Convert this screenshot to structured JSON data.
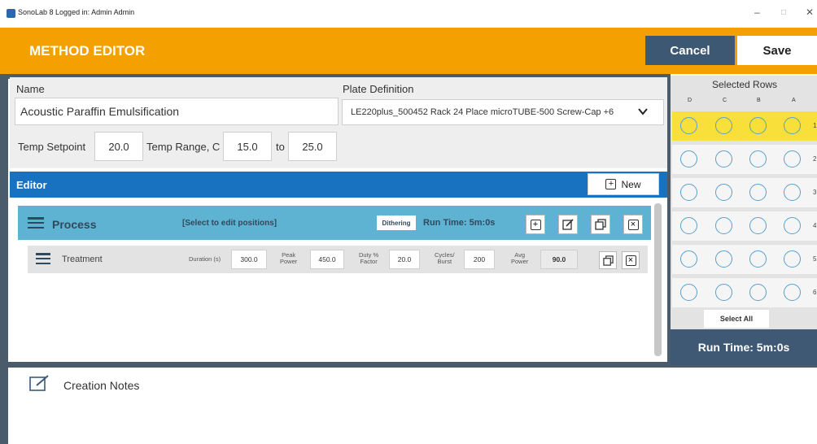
{
  "window": {
    "title": "SonoLab 8 Logged in: Admin Admin",
    "minimize": "–",
    "maximize": "□",
    "close": "✕"
  },
  "header": {
    "title": "METHOD EDITOR",
    "cancel_label": "Cancel",
    "save_label": "Save"
  },
  "method": {
    "name_label": "Name",
    "name_value": "Acoustic Paraffin Emulsification",
    "plate_label": "Plate Definition",
    "plate_value": "LE220plus_500452 Rack 24 Place microTUBE-500 Screw-Cap +6",
    "temp_setpoint_label": "Temp Setpoint",
    "temp_setpoint_value": "20.0",
    "temp_range_label": "Temp Range, C",
    "temp_range_min": "15.0",
    "temp_range_to": "to",
    "temp_range_max": "25.0"
  },
  "editor": {
    "title": "Editor",
    "new_label": "New",
    "process": {
      "label": "Process",
      "positions": "[Select to edit positions]",
      "dithering": "Dithering",
      "run_time": "Run Time: 5m:0s"
    },
    "treatment": {
      "label": "Treatment",
      "duration_label": "Duration (s)",
      "duration_value": "300.0",
      "peak_power_label": [
        "Peak",
        "Power"
      ],
      "peak_power_value": "450.0",
      "duty_factor_label": [
        "Duty %",
        "Factor"
      ],
      "duty_factor_value": "20.0",
      "cycles_label": [
        "Cycles/",
        "Burst"
      ],
      "cycles_value": "200",
      "avg_power_label": [
        "Avg",
        "Power"
      ],
      "avg_power_value": "90.0"
    }
  },
  "notes": {
    "label": "Creation Notes"
  },
  "selected_rows": {
    "title": "Selected Rows",
    "columns": [
      "D",
      "C",
      "B",
      "A"
    ],
    "row_numbers": [
      "1",
      "2",
      "3",
      "4",
      "5",
      "6"
    ],
    "highlighted_row": 1,
    "select_all_label": "Select All"
  },
  "run_time": "Run Time: 5m:0s",
  "colors": {
    "header": "#f3a000",
    "editor_bar": "#1972c0",
    "process_row": "#5fb3d2",
    "dark_panel": "#3f5874",
    "highlight": "#f8df3a"
  }
}
